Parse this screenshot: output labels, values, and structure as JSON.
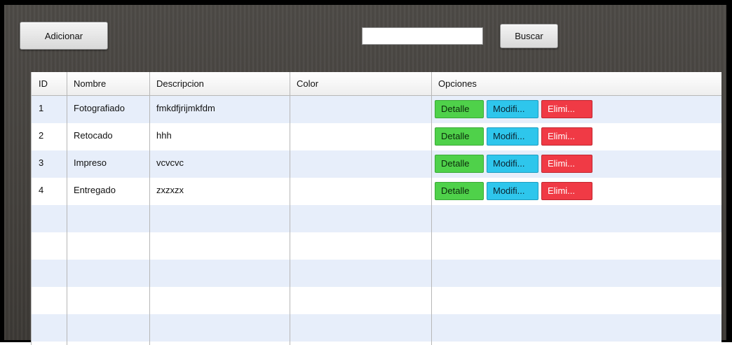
{
  "toolbar": {
    "add_label": "Adicionar",
    "search_value": "",
    "search_label": "Buscar"
  },
  "table": {
    "columns": [
      "ID",
      "Nombre",
      "Descripcion",
      "Color",
      "Opciones"
    ],
    "rows": [
      {
        "id": "1",
        "nombre": "Fotografiado",
        "descripcion": "fmkdfjrijmkfdm",
        "color": ""
      },
      {
        "id": "2",
        "nombre": "Retocado",
        "descripcion": "hhh",
        "color": ""
      },
      {
        "id": "3",
        "nombre": "Impreso",
        "descripcion": "vcvcvc",
        "color": ""
      },
      {
        "id": "4",
        "nombre": "Entregado",
        "descripcion": "zxzxzx",
        "color": ""
      }
    ],
    "actions": {
      "detail": "Detalle",
      "modify": "Modifi...",
      "delete": "Elimi..."
    }
  },
  "colors": {
    "detail": "#4fd14a",
    "modify": "#2ec6ec",
    "delete": "#f03a45",
    "row_alt": "#e7eefa"
  }
}
